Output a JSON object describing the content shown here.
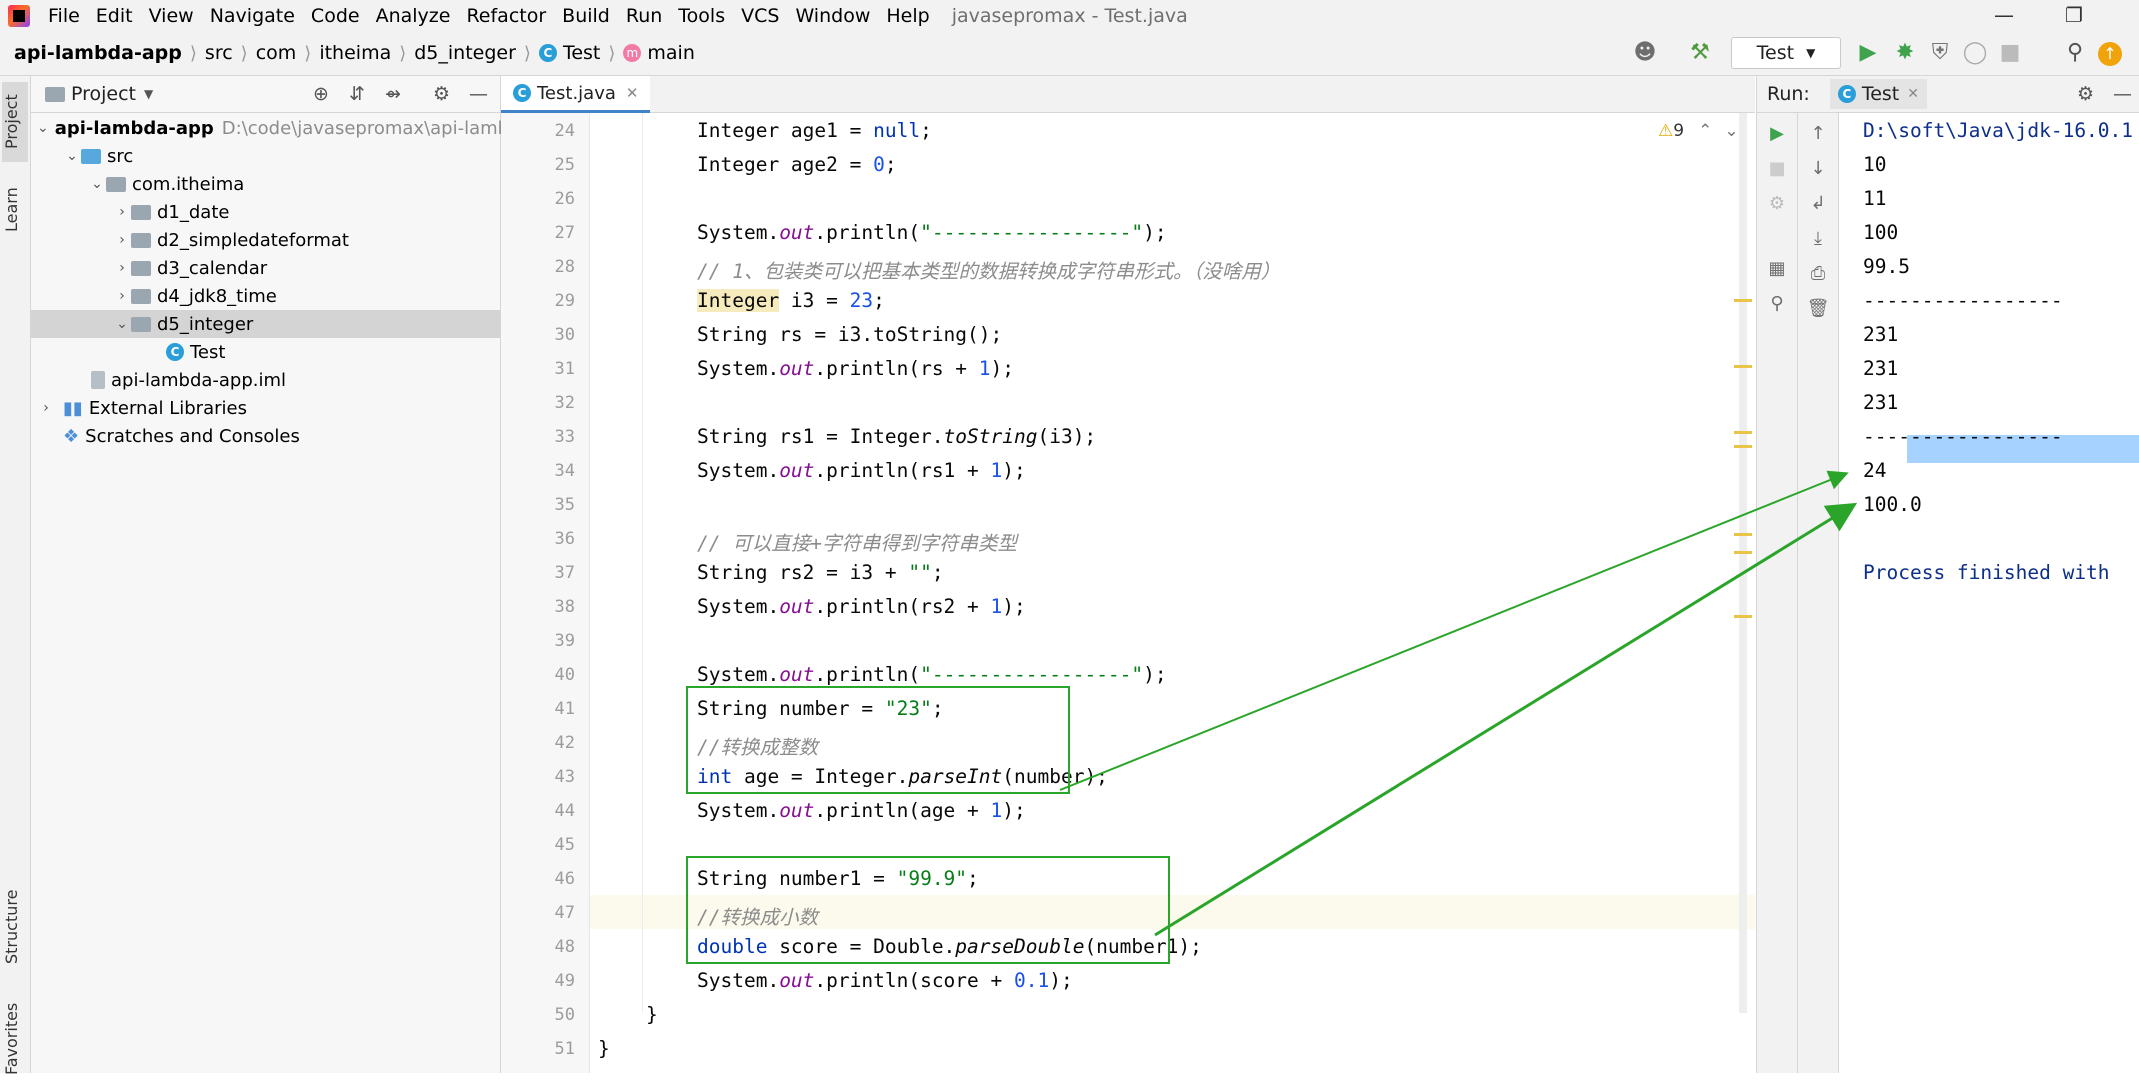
{
  "window": {
    "title": "javasepromax - Test.java",
    "menu": [
      "File",
      "Edit",
      "View",
      "Navigate",
      "Code",
      "Analyze",
      "Refactor",
      "Build",
      "Run",
      "Tools",
      "VCS",
      "Window",
      "Help"
    ]
  },
  "breadcrumb": [
    "api-lambda-app",
    "src",
    "com",
    "itheima",
    "d5_integer",
    "Test",
    "main"
  ],
  "toolbar": {
    "run_config": "Test"
  },
  "side_tabs": {
    "project": "Project",
    "learn": "Learn",
    "structure": "Structure",
    "favorites": "Favorites"
  },
  "project_panel": {
    "title": "Project",
    "tree": [
      {
        "label": "api-lambda-app",
        "path": "D:\\code\\javasepromax\\api-lamb",
        "level": 0
      },
      {
        "label": "src",
        "level": 1
      },
      {
        "label": "com.itheima",
        "level": 2
      },
      {
        "label": "d1_date",
        "level": 3
      },
      {
        "label": "d2_simpledateformat",
        "level": 3
      },
      {
        "label": "d3_calendar",
        "level": 3
      },
      {
        "label": "d4_jdk8_time",
        "level": 3
      },
      {
        "label": "d5_integer",
        "level": 3,
        "selected": true
      },
      {
        "label": "Test",
        "level": 4
      },
      {
        "label": "api-lambda-app.iml",
        "level": 2
      },
      {
        "label": "External Libraries",
        "level": 0
      },
      {
        "label": "Scratches and Consoles",
        "level": 0
      }
    ]
  },
  "editor": {
    "tab": "Test.java",
    "warning_count": "9",
    "line_numbers": [
      "24",
      "25",
      "26",
      "27",
      "28",
      "29",
      "30",
      "31",
      "32",
      "33",
      "34",
      "35",
      "36",
      "37",
      "38",
      "39",
      "40",
      "41",
      "42",
      "43",
      "44",
      "45",
      "46",
      "47",
      "48",
      "49",
      "50",
      "51"
    ]
  },
  "run_panel": {
    "label": "Run:",
    "tab": "Test",
    "output": [
      "D:\\soft\\Java\\jdk-16.0.1",
      "10",
      "11",
      "100",
      "99.5",
      "-----------------",
      "231",
      "231",
      "231",
      "-----------------",
      "24",
      "100.0",
      "",
      "Process finished with"
    ]
  },
  "colors": {
    "annotation": "#2aa52a",
    "selection": "#a6d2ff"
  }
}
